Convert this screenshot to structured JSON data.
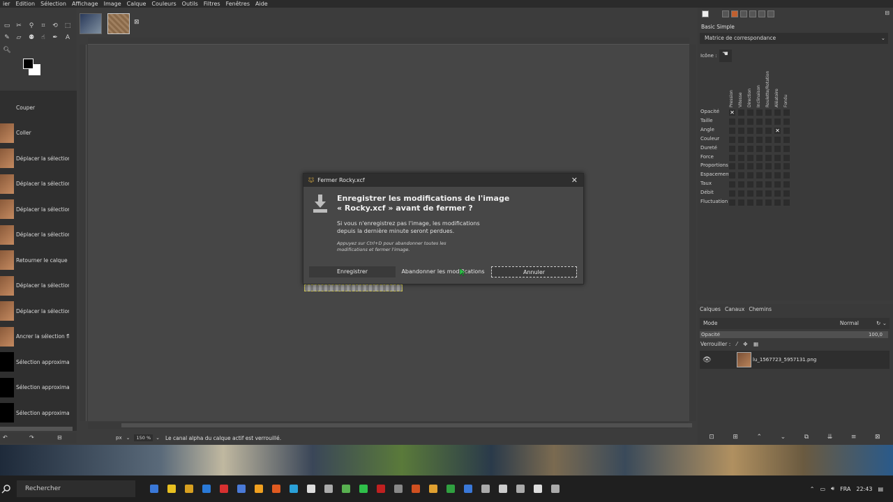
{
  "menubar": [
    "ier",
    "Edition",
    "Sélection",
    "Affichage",
    "Image",
    "Calque",
    "Couleurs",
    "Outils",
    "Filtres",
    "Fenêtres",
    "Aide"
  ],
  "history": {
    "items": [
      {
        "label": "Couper",
        "thumb": "blank"
      },
      {
        "label": "Coller",
        "thumb": "image"
      },
      {
        "label": "Déplacer la sélection flo",
        "thumb": "image"
      },
      {
        "label": "Déplacer la sélection flo",
        "thumb": "image"
      },
      {
        "label": "Déplacer la sélection flo",
        "thumb": "image"
      },
      {
        "label": "Déplacer la sélection flo",
        "thumb": "image"
      },
      {
        "label": "Retourner le calque",
        "thumb": "image"
      },
      {
        "label": "Déplacer la sélection flo",
        "thumb": "image"
      },
      {
        "label": "Déplacer la sélection flo",
        "thumb": "image"
      },
      {
        "label": "Ancrer la sélection flotti",
        "thumb": "image"
      },
      {
        "label": "Sélection approximativ",
        "thumb": "black"
      },
      {
        "label": "Sélection approximativ",
        "thumb": "black"
      },
      {
        "label": "Sélection approximativ",
        "thumb": "black"
      }
    ]
  },
  "statusbar": {
    "unit": "px",
    "zoom": "150 %",
    "message": "Le canal alpha du calque actif est verrouillé."
  },
  "dialog": {
    "title": "Fermer Rocky.xcf",
    "heading_line1": "Enregistrer les modifications de l'image",
    "heading_line2": "« Rocky.xcf » avant de fermer ?",
    "body_line1": "Si vous n'enregistrez pas l'image, les modifications",
    "body_line2": "depuis la dernière minute seront perdues.",
    "hint_line1": "Appuyez sur Ctrl+D pour abandonner toutes les",
    "hint_line2": "modifications et fermer l'image.",
    "save_label": "Enregistrer",
    "discard_label": "Abandonner les modifications",
    "cancel_label": "Annuler"
  },
  "dynamics": {
    "preset": "Basic Simple",
    "matrix_label": "Matrice de correspondance",
    "icon_label": "Icône :",
    "columns": [
      "Pression",
      "Vitesse",
      "Direction",
      "Inclinaison",
      "Roulette/Rotation",
      "Aléatoire",
      "Fondu"
    ],
    "rows": [
      "Opacité",
      "Taille",
      "Angle",
      "Couleur",
      "Dureté",
      "Force",
      "Proportions",
      "Espacement",
      "Taux",
      "Débit",
      "Fluctuation"
    ],
    "checked": [
      [
        0,
        0
      ],
      [
        2,
        5
      ]
    ]
  },
  "layers": {
    "tabs": [
      "Calques",
      "Canaux",
      "Chemins"
    ],
    "mode_label": "Mode",
    "mode_value": "Normal",
    "opacity_label": "Opacité",
    "opacity_value": "100,0",
    "lock_label": "Verrouiller :",
    "layer_name": "lu_1567723_5957131.png"
  },
  "taskbar": {
    "search_placeholder": "Rechercher",
    "lang": "FRA",
    "time": "22:43"
  },
  "colors": {
    "accent_green": "#2fbf4a",
    "dialog_bg": "#474747"
  }
}
